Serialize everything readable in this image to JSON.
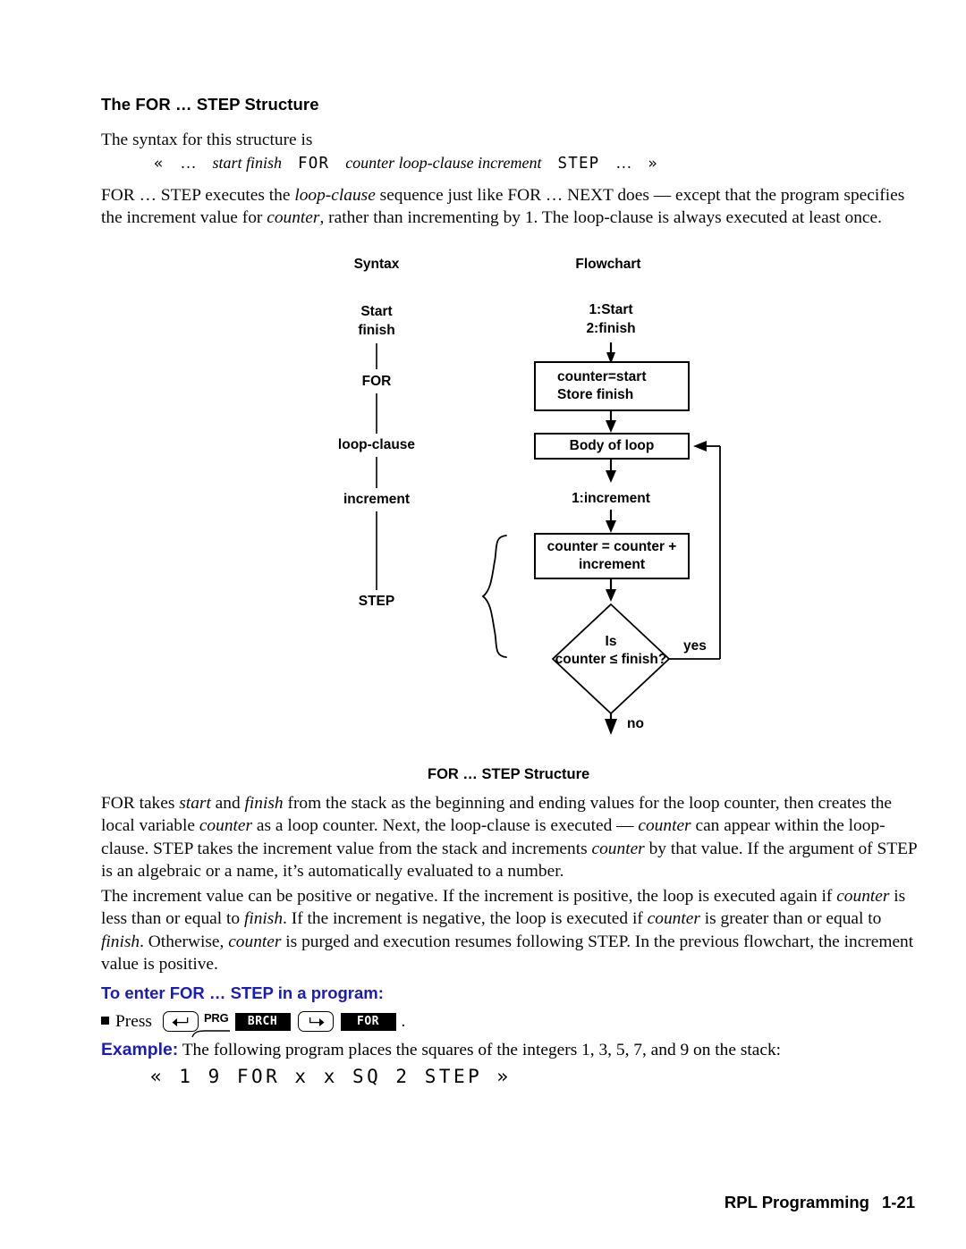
{
  "document": {
    "section_heading": "The FOR … STEP Structure",
    "intro": "The syntax for this structure is",
    "syntax": {
      "open_guillemet": "«",
      "ellipsis1": "…",
      "args": "start finish",
      "cmd1": "FOR",
      "args2": "counter loop-clause increment",
      "cmd2": "STEP",
      "ellipsis2": "…",
      "close_guillemet": "»"
    },
    "paragraph_1_a": "FOR … STEP executes the ",
    "paragraph_1_b": "loop-clause",
    "paragraph_1_c": " sequence just like FOR … NEXT does — except that the program specifies the increment value for ",
    "paragraph_1_d": "counter",
    "paragraph_1_e": ", rather than incrementing by 1. The loop-clause is always executed at least once.",
    "paragraph_2_a": "FOR takes ",
    "paragraph_2_b": "start",
    "paragraph_2_c": " and ",
    "paragraph_2_d": "finish",
    "paragraph_2_e": " from the stack as the beginning and ending values for the loop counter, then creates the local variable ",
    "paragraph_2_f": "counter",
    "paragraph_2_g": " as a loop counter. Next, the loop-clause is executed — ",
    "paragraph_2_h": "counter",
    "paragraph_2_i": " can appear within the loop-clause. STEP takes the increment value from the stack and increments ",
    "paragraph_2_j": "counter",
    "paragraph_2_k": " by that value. If the argument of STEP is an algebraic or a name, it’s automatically evaluated to a number.",
    "paragraph_3_a": "The increment value can be positive or negative. If the increment is positive, the loop is executed again if ",
    "paragraph_3_b": "counter",
    "paragraph_3_c": " is less than or equal to ",
    "paragraph_3_d": "finish",
    "paragraph_3_e": ". If the increment is negative, the loop is executed if ",
    "paragraph_3_f": "counter",
    "paragraph_3_g": " is greater than or equal to ",
    "paragraph_3_h": "finish",
    "paragraph_3_i": ". Otherwise, ",
    "paragraph_3_j": "counter",
    "paragraph_3_k": " is purged and execution resumes following STEP. In the previous flowchart, the increment value is positive."
  },
  "flowchart": {
    "col_head_syntax": "Syntax",
    "col_head_flowchart": "Flowchart",
    "caption": "FOR … STEP Structure",
    "syntax_column": [
      "Start",
      "finish",
      "FOR",
      "loop-clause",
      "increment",
      "STEP"
    ],
    "stack_in_line1": "1:Start",
    "stack_in_line2": "2:finish",
    "box_init_line1": "counter=start",
    "box_init_line2": "Store finish",
    "box_body": "Body of loop",
    "stack_increment": "1:increment",
    "box_update_line1": "counter = counter +",
    "box_update_line2": "increment",
    "decision_line1": "Is",
    "decision_line2": "counter ≤ finish?",
    "branch_yes": "yes",
    "branch_no": "no"
  },
  "procedure": {
    "heading": "To enter FOR … STEP in a program:",
    "press_label": "Press",
    "key_left_shift": "left-shift",
    "key_prg_label": "PRG",
    "softkey_brch": "BRCH",
    "key_right_shift": "right-shift",
    "softkey_for": "FOR",
    "trailing_period": ".",
    "example_label": "Example:",
    "example_text": " The following program places the squares of the integers 1, 3, 5, 7, and 9 on the stack:",
    "example_program": "« 1 9 FOR x x SQ 2 STEP »"
  },
  "footer": {
    "title": "RPL Programming",
    "page": "1-21"
  },
  "colors": {
    "accent_blue": "#1b1bbd",
    "text_black": "#000000",
    "page_background": "#ffffff"
  }
}
